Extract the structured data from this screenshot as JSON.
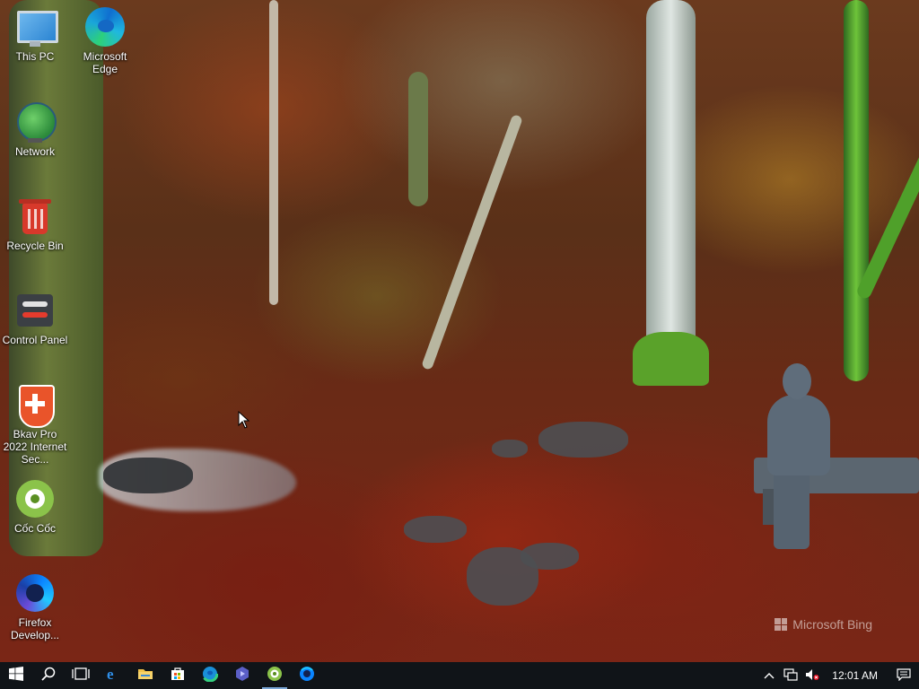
{
  "desktop": {
    "icons": [
      {
        "label": "This PC",
        "icon": "this-pc-icon"
      },
      {
        "label": "Microsoft Edge",
        "icon": "edge-icon"
      },
      {
        "label": "Network",
        "icon": "network-icon"
      },
      {
        "label": "Recycle Bin",
        "icon": "recycle-bin-icon"
      },
      {
        "label": "Control Panel",
        "icon": "control-panel-icon"
      },
      {
        "label": "Bkav Pro 2022 Internet Sec...",
        "icon": "bkav-icon"
      },
      {
        "label": "Cốc Cốc",
        "icon": "coccoc-icon"
      },
      {
        "label": "Firefox Develop...",
        "icon": "firefox-developer-icon"
      }
    ],
    "watermark": "Microsoft Bing"
  },
  "taskbar": {
    "buttons": [
      {
        "name": "start-button",
        "icon": "windows-logo-icon"
      },
      {
        "name": "search-button",
        "icon": "search-icon"
      },
      {
        "name": "task-view-button",
        "icon": "task-view-icon"
      },
      {
        "name": "taskbar-internet-explorer",
        "icon": "internet-explorer-icon"
      },
      {
        "name": "taskbar-file-explorer",
        "icon": "folder-icon"
      },
      {
        "name": "taskbar-microsoft-store",
        "icon": "store-icon"
      },
      {
        "name": "taskbar-edge",
        "icon": "edge-icon"
      },
      {
        "name": "taskbar-power-automate",
        "icon": "power-automate-icon"
      },
      {
        "name": "taskbar-coccoc",
        "icon": "coccoc-icon"
      },
      {
        "name": "taskbar-firefox-developer",
        "icon": "firefox-developer-icon"
      }
    ],
    "tray": {
      "clock": "12:01 AM",
      "icons": [
        "chevron-up-icon",
        "network-tray-icon",
        "volume-muted-icon",
        "notification-icon"
      ]
    }
  },
  "colors": {
    "taskbar_bg": "#101418",
    "accent": "#7aa6d6"
  }
}
